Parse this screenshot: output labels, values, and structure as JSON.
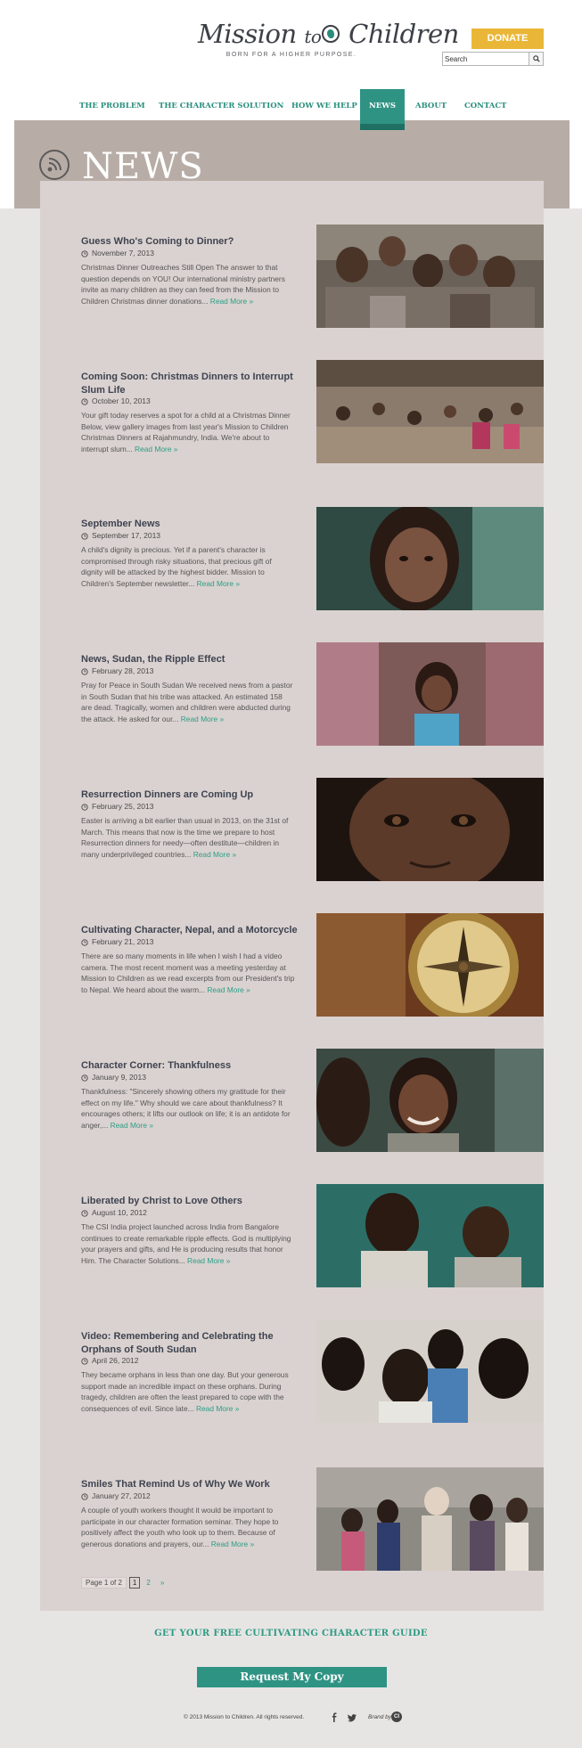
{
  "header": {
    "logo_text_a": "Mission",
    "logo_text_b": "to",
    "logo_text_c": "Children",
    "logo_tagline": "BORN FOR A HIGHER PURPOSE.",
    "donate_label": "DONATE",
    "search_value": "Search",
    "search_icon": "magnifier-icon"
  },
  "nav": {
    "items": [
      {
        "label": "THE PROBLEM",
        "active": false
      },
      {
        "label": "THE CHARACTER SOLUTION",
        "active": false
      },
      {
        "label": "HOW WE HELP",
        "active": false
      },
      {
        "label": "NEWS",
        "active": true
      },
      {
        "label": "ABOUT",
        "active": false
      },
      {
        "label": "CONTACT",
        "active": false
      }
    ]
  },
  "banner": {
    "title": "NEWS",
    "icon": "rss-feed-icon"
  },
  "posts": [
    {
      "title": "Guess Who's Coming to Dinner?",
      "date": "November 7, 2013",
      "excerpt": "Christmas Dinner Outreaches Still Open The answer to that question depends on YOU! Our international ministry partners invite as many children as they can feed from the Mission to Children Christmas dinner donations...",
      "read_more": "Read More »"
    },
    {
      "title": "Coming Soon: Christmas Dinners to Interrupt Slum Life",
      "date": "October 10, 2013",
      "excerpt": "Your gift today reserves a spot for a child at a Christmas Dinner Below, view gallery images from last year's Mission to Children Christmas Dinners at Rajahmundry, India. We're about to interrupt slum...",
      "read_more": "Read More »"
    },
    {
      "title": "September News",
      "date": "September 17, 2013",
      "excerpt": "A child's dignity is precious. Yet if a parent's character is compromised through risky situations, that precious gift of dignity will be attacked by the highest bidder. Mission to Children's September newsletter...",
      "read_more": "Read More »"
    },
    {
      "title": "News, Sudan, the Ripple Effect",
      "date": "February 28, 2013",
      "excerpt": "Pray for Peace in South Sudan We received news from a pastor in South Sudan that his tribe was attacked. An estimated 158 are dead. Tragically, women and children were abducted during the attack. He asked for our...",
      "read_more": "Read More »"
    },
    {
      "title": "Resurrection Dinners are Coming Up",
      "date": "February 25, 2013",
      "excerpt": "Easter is arriving a bit earlier than usual in 2013, on the 31st of March. This means that now is the time we prepare to host Resurrection dinners for needy—often destitute—children in many underprivileged countries...",
      "read_more": "Read More »"
    },
    {
      "title": "Cultivating Character, Nepal, and a Motorcycle",
      "date": "February 21, 2013",
      "excerpt": "There are so many moments in life when I wish I had a video camera. The most recent moment was a meeting yesterday at Mission to Children as we read excerpts from our President's trip to Nepal. We heard about the warm...",
      "read_more": "Read More »"
    },
    {
      "title": "Character Corner: Thankfulness",
      "date": "January 9, 2013",
      "excerpt": "Thankfulness: \"Sincerely showing others my gratitude for their effect on my life.\" Why should we care about thankfulness? It encourages others; it lifts our outlook on life; it is an antidote for anger,...",
      "read_more": "Read More »"
    },
    {
      "title": "Liberated by Christ to Love Others",
      "date": "August 10, 2012",
      "excerpt": "The CSI India project launched across India from Bangalore continues to create remarkable ripple effects. God is multiplying your prayers and gifts, and He is producing results that honor Him. The Character Solutions...",
      "read_more": "Read More »"
    },
    {
      "title": "Video: Remembering and Celebrating the Orphans of South Sudan",
      "date": "April 26, 2012",
      "excerpt": "They became orphans in less than one day. But your generous support made an incredible impact on these orphans. During tragedy, children are often the least prepared to cope with the consequences of evil. Since late...",
      "read_more": "Read More »"
    },
    {
      "title": "Smiles That Remind Us of Why We Work",
      "date": "January 27, 2012",
      "excerpt": "A couple of youth workers thought it would be important to participate in our character formation seminar. They hope to positively affect the youth who look up to them. Because of generous donations and prayers, our...",
      "read_more": "Read More »"
    }
  ],
  "pagination": {
    "summary": "Page 1 of 2",
    "current": "1",
    "next_page": "2",
    "next_arrow": "»"
  },
  "footer": {
    "guide_heading": "GET YOUR FREE CULTIVATING CHARACTER GUIDE",
    "request_label": "Request My Copy",
    "copyright": "© 2013 Mission to Children. All rights reserved.",
    "brand_label": "Brand by",
    "brand_mark": "CI",
    "social": [
      "facebook-icon",
      "twitter-icon"
    ]
  },
  "colors": {
    "accent_teal": "#2f9384",
    "donate_yellow": "#eab637",
    "content_bg": "#dad2d0",
    "banner_bg": "#b8ada6"
  }
}
